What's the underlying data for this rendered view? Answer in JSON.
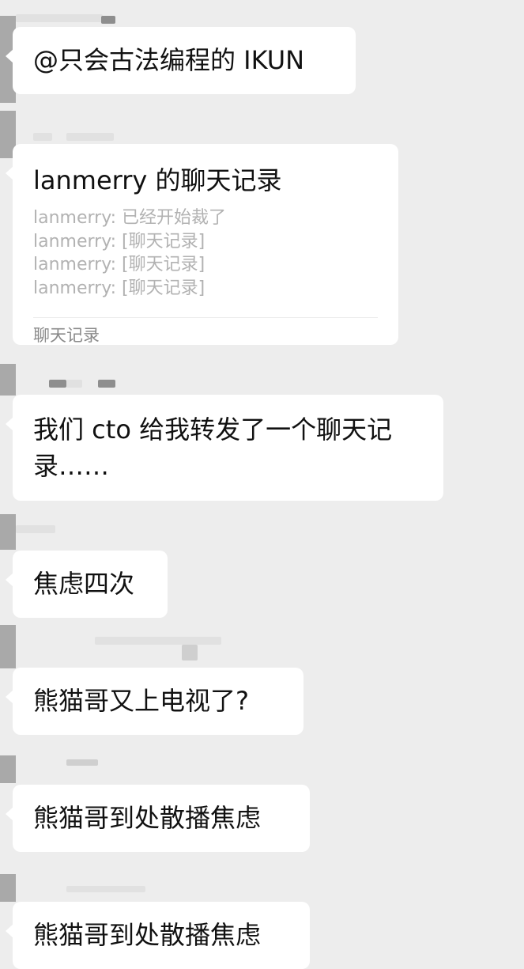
{
  "messages": [
    {
      "type": "text",
      "text": "@只会古法编程的 IKUN"
    },
    {
      "type": "chat_record",
      "title": "lanmerry 的聊天记录",
      "lines": [
        "lanmerry: 已经开始裁了",
        "lanmerry: [聊天记录]",
        "lanmerry: [聊天记录]",
        "lanmerry: [聊天记录]"
      ],
      "footer": "聊天记录"
    },
    {
      "type": "text",
      "text": "我们 cto 给我转发了一个聊天记录……"
    },
    {
      "type": "text",
      "text": "焦虑四次"
    },
    {
      "type": "text",
      "text": "熊猫哥又上电视了?"
    },
    {
      "type": "text",
      "text": "熊猫哥到处散播焦虑"
    },
    {
      "type": "text",
      "text": "熊猫哥到处散播焦虑"
    }
  ],
  "colors": {
    "background": "#ededed",
    "bubble": "#ffffff",
    "preview_text": "#b2b2b2"
  }
}
